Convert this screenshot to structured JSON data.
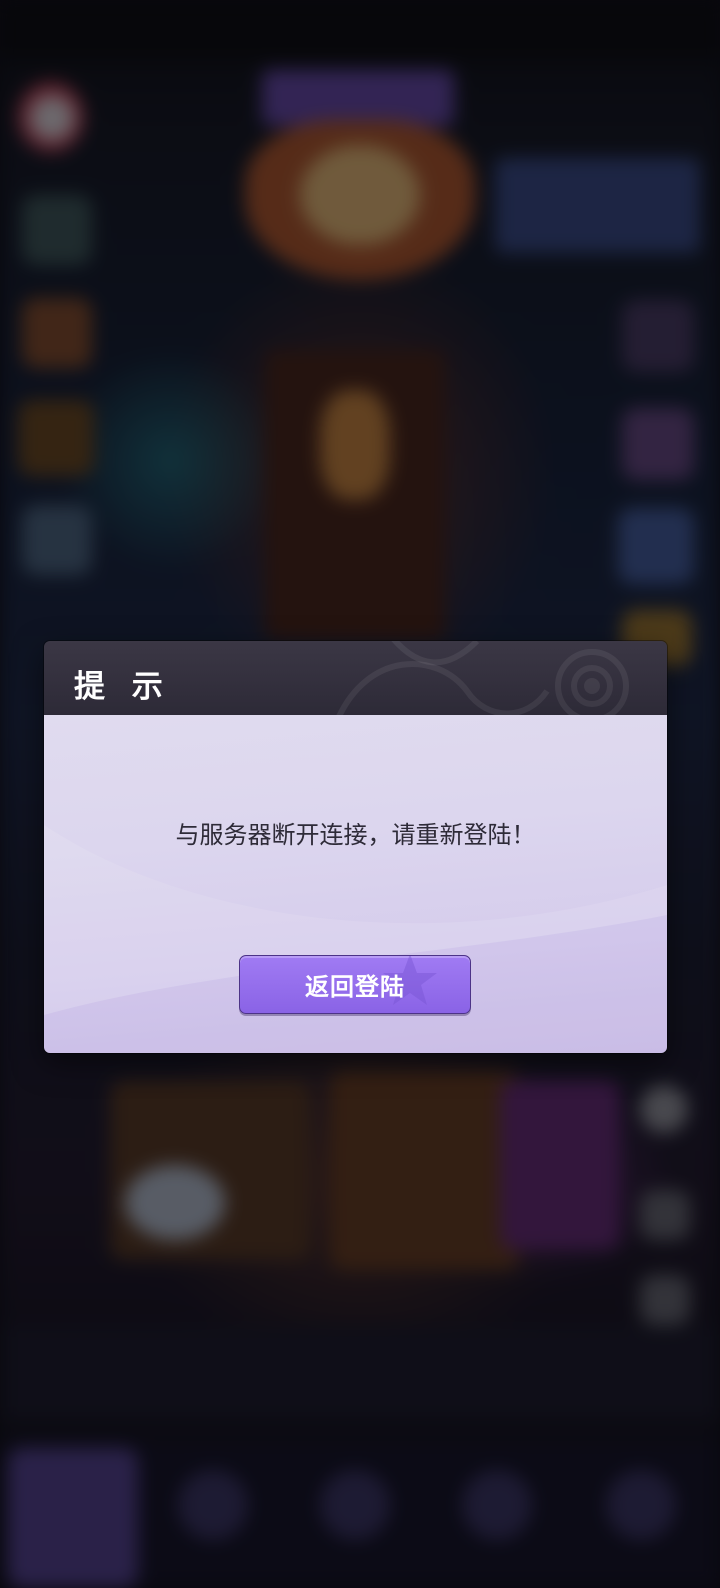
{
  "dialog": {
    "title": "提 示",
    "message": "与服务器断开连接，请重新登陆！",
    "button_label": "返回登陆"
  },
  "colors": {
    "dialog_header": "#2d2a37",
    "dialog_body": "#dcd6ee",
    "button": "#9570ee",
    "button_border": "#4c3387"
  },
  "background": {
    "state": "blurred game lobby behind modal"
  }
}
